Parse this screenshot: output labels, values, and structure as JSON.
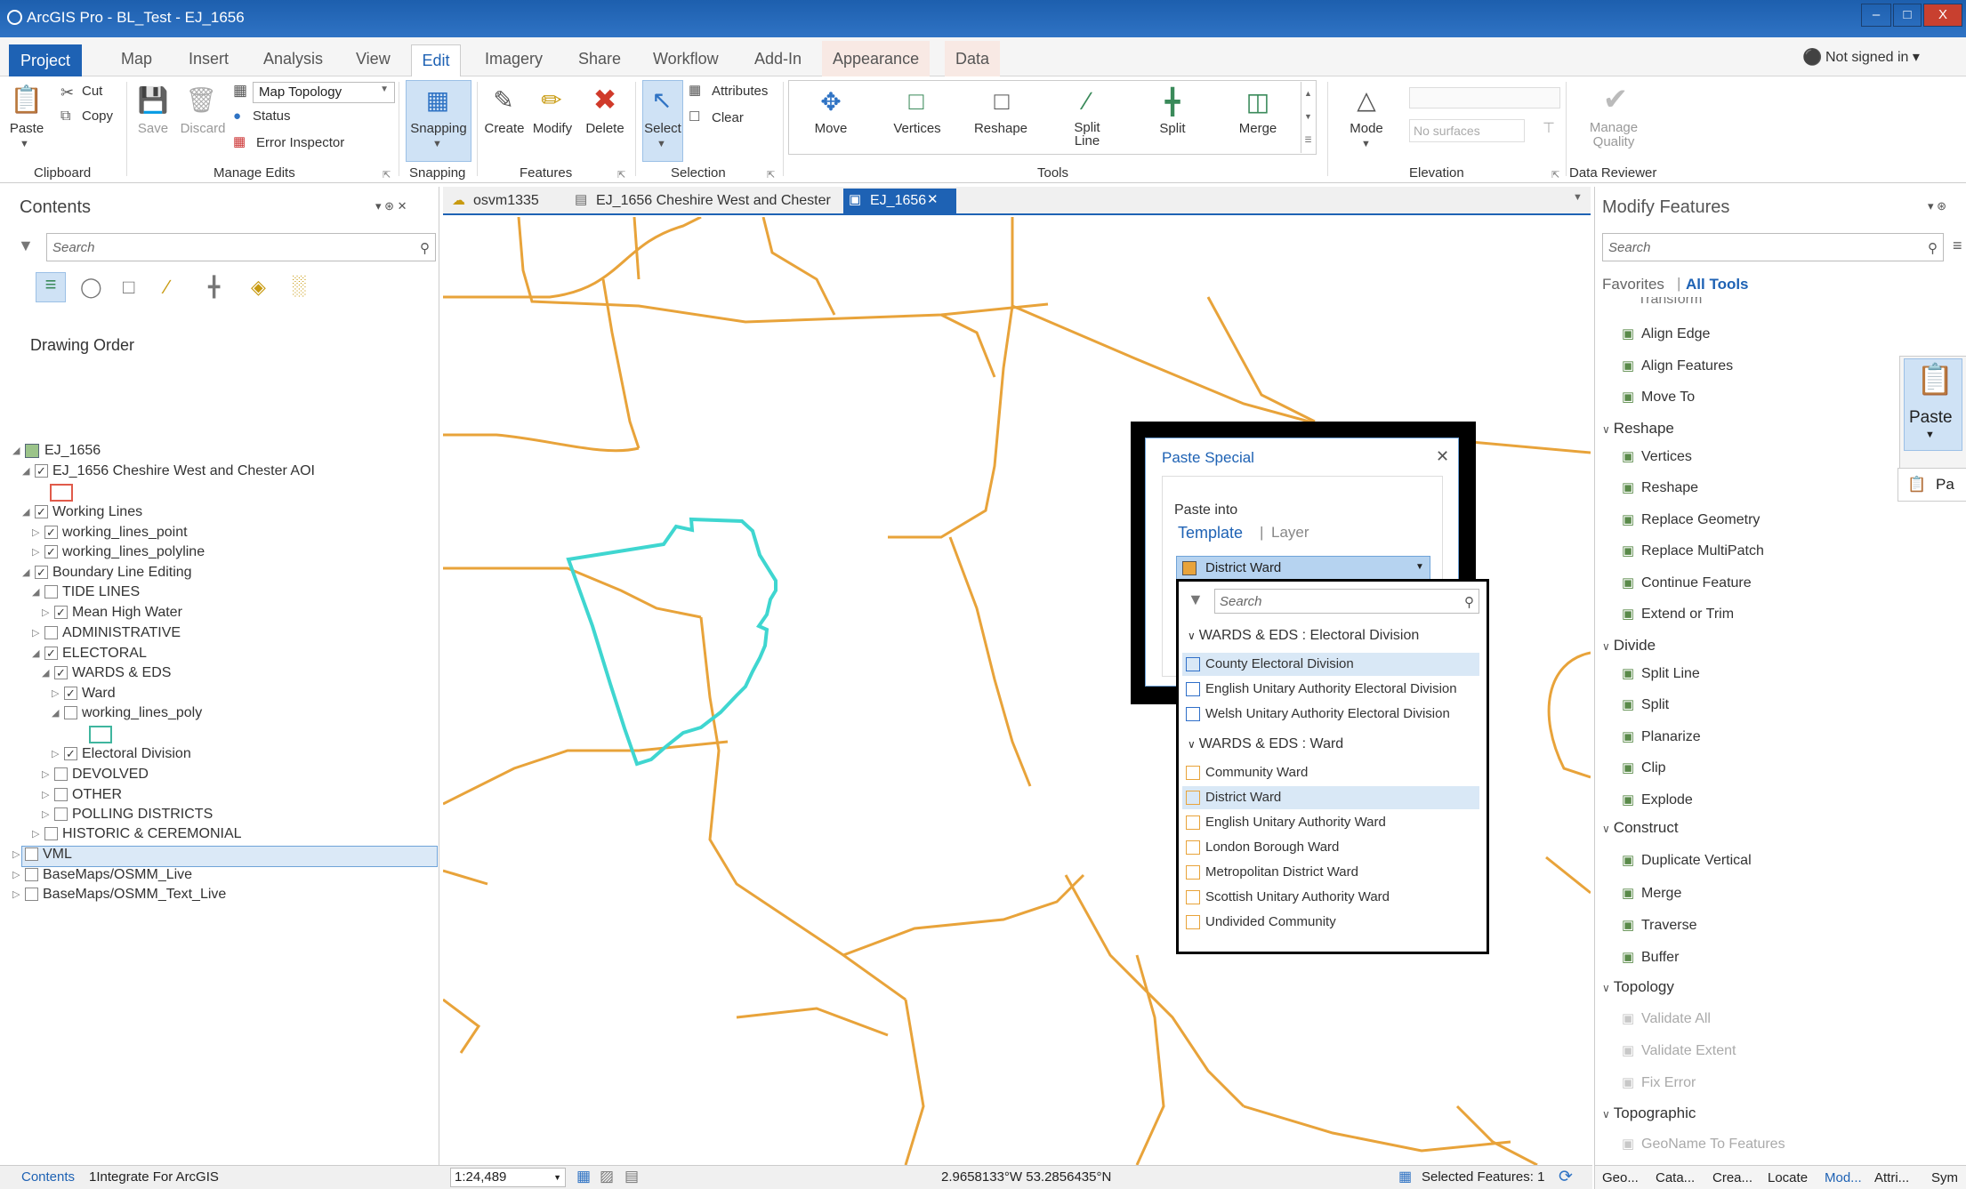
{
  "window": {
    "title": "ArcGIS Pro - BL_Test - EJ_1656",
    "minimize": "–",
    "maximize": "□",
    "close": "X"
  },
  "ribbon_tabs": [
    "Project",
    "Map",
    "Insert",
    "Analysis",
    "View",
    "Edit",
    "Imagery",
    "Share",
    "Workflow",
    "Add-In",
    "Appearance",
    "Data"
  ],
  "signin": "Not signed in ▾",
  "ribbon": {
    "paste": "Paste",
    "cut": "Cut",
    "copy": "Copy",
    "save": "Save",
    "discard": "Discard",
    "map_topology": "Map Topology",
    "status": "Status",
    "error_inspector": "Error Inspector",
    "snapping": "Snapping",
    "create": "Create",
    "modify": "Modify",
    "delete": "Delete",
    "select": "Select",
    "attributes": "Attributes",
    "clear": "Clear",
    "move": "Move",
    "vertices": "Vertices",
    "reshape": "Reshape",
    "split_line": "Split\nLine",
    "split": "Split",
    "merge": "Merge",
    "mode": "Mode",
    "no_surfaces": "No surfaces",
    "manage_quality": "Manage\nQuality",
    "groups": {
      "clipboard": "Clipboard",
      "manage_edits": "Manage Edits",
      "snapping": "Snapping",
      "features": "Features",
      "selection": "Selection",
      "tools": "Tools",
      "elevation": "Elevation",
      "data_reviewer": "Data Reviewer"
    }
  },
  "doc_tabs": [
    "osvm1335",
    "EJ_1656 Cheshire West and Chester",
    "EJ_1656"
  ],
  "contents": {
    "title": "Contents",
    "search_placeholder": "Search",
    "drawing_order": "Drawing Order",
    "tree": [
      {
        "label": "EJ_1656",
        "indent": 0,
        "checked": null,
        "expanded": true
      },
      {
        "label": "EJ_1656 Cheshire West and Chester AOI",
        "indent": 1,
        "checked": true,
        "expanded": true
      },
      {
        "label": "Working Lines",
        "indent": 1,
        "checked": true,
        "expanded": true
      },
      {
        "label": "working_lines_point",
        "indent": 2,
        "checked": true,
        "expanded": false
      },
      {
        "label": "working_lines_polyline",
        "indent": 2,
        "checked": true,
        "expanded": false
      },
      {
        "label": "Boundary Line Editing",
        "indent": 1,
        "checked": true,
        "expanded": true
      },
      {
        "label": "TIDE LINES",
        "indent": 2,
        "checked": false,
        "expanded": true
      },
      {
        "label": "Mean High Water",
        "indent": 3,
        "checked": true,
        "expanded": false
      },
      {
        "label": "ADMINISTRATIVE",
        "indent": 2,
        "checked": false,
        "expanded": false
      },
      {
        "label": "ELECTORAL",
        "indent": 2,
        "checked": true,
        "expanded": true
      },
      {
        "label": "WARDS & EDS",
        "indent": 3,
        "checked": true,
        "expanded": true
      },
      {
        "label": "Ward",
        "indent": 4,
        "checked": true,
        "expanded": false
      },
      {
        "label": "working_lines_poly",
        "indent": 4,
        "checked": false,
        "expanded": true
      },
      {
        "label": "Electoral Division",
        "indent": 4,
        "checked": true,
        "expanded": false
      },
      {
        "label": "DEVOLVED",
        "indent": 3,
        "checked": false,
        "expanded": false
      },
      {
        "label": "OTHER",
        "indent": 3,
        "checked": false,
        "expanded": false
      },
      {
        "label": "POLLING DISTRICTS",
        "indent": 3,
        "checked": false,
        "expanded": false
      },
      {
        "label": "HISTORIC & CEREMONIAL",
        "indent": 2,
        "checked": false,
        "expanded": false
      },
      {
        "label": "VML",
        "indent": 0,
        "checked": false,
        "expanded": false
      },
      {
        "label": "BaseMaps/OSMM_Live",
        "indent": 0,
        "checked": false,
        "expanded": false
      },
      {
        "label": "BaseMaps/OSMM_Text_Live",
        "indent": 0,
        "checked": false,
        "expanded": false
      }
    ]
  },
  "status": {
    "scale": "1:24,489",
    "coords": "2.9658133°W 53.2856435°N",
    "selected": "Selected Features: 1",
    "bottom_tabs": [
      "Contents",
      "1Integrate For ArcGIS"
    ]
  },
  "modify": {
    "title": "Modify Features",
    "search_placeholder": "Search",
    "favorites": "Favorites",
    "all_tools": "All Tools",
    "cut_off": "Transform",
    "items": [
      {
        "kind": "item",
        "label": "Align Edge"
      },
      {
        "kind": "item",
        "label": "Align Features"
      },
      {
        "kind": "item",
        "label": "Move To"
      },
      {
        "kind": "hdr",
        "label": "Reshape"
      },
      {
        "kind": "item",
        "label": "Vertices"
      },
      {
        "kind": "item",
        "label": "Reshape"
      },
      {
        "kind": "item",
        "label": "Replace Geometry"
      },
      {
        "kind": "item",
        "label": "Replace MultiPatch"
      },
      {
        "kind": "item",
        "label": "Continue Feature"
      },
      {
        "kind": "item",
        "label": "Extend or Trim"
      },
      {
        "kind": "hdr",
        "label": "Divide"
      },
      {
        "kind": "item",
        "label": "Split Line"
      },
      {
        "kind": "item",
        "label": "Split"
      },
      {
        "kind": "item",
        "label": "Planarize"
      },
      {
        "kind": "item",
        "label": "Clip"
      },
      {
        "kind": "item",
        "label": "Explode"
      },
      {
        "kind": "hdr",
        "label": "Construct"
      },
      {
        "kind": "item",
        "label": "Duplicate Vertical"
      },
      {
        "kind": "item",
        "label": "Merge"
      },
      {
        "kind": "item",
        "label": "Traverse"
      },
      {
        "kind": "item",
        "label": "Buffer"
      },
      {
        "kind": "hdr",
        "label": "Topology"
      },
      {
        "kind": "dis",
        "label": "Validate All"
      },
      {
        "kind": "dis",
        "label": "Validate Extent"
      },
      {
        "kind": "dis",
        "label": "Fix Error"
      },
      {
        "kind": "hdr",
        "label": "Topographic"
      },
      {
        "kind": "dis",
        "label": "GeoName To Features"
      }
    ],
    "bottom_tabs": [
      "Geo...",
      "Cata...",
      "Crea...",
      "Locate",
      "Mod...",
      "Attri...",
      "Sym"
    ],
    "paste_flyout": "Paste",
    "paste_flyout_item": "Pa"
  },
  "dialog": {
    "title": "Paste Special",
    "paste_into": "Paste into",
    "template_tab": "Template",
    "layer_tab": "Layer",
    "selected": "District Ward",
    "search_placeholder": "Search",
    "groups": [
      {
        "name": "WARDS & EDS : Electoral Division",
        "color": "#2f6fc9",
        "items": [
          "County Electoral Division",
          "English Unitary Authority Electoral Division",
          "Welsh Unitary Authority Electoral Division"
        ]
      },
      {
        "name": "WARDS & EDS : Ward",
        "color": "#e8a33a",
        "items": [
          "Community Ward",
          "District Ward",
          "English Unitary Authority Ward",
          "London Borough Ward",
          "Metropolitan District Ward",
          "Scottish Unitary Authority Ward",
          "Undivided Community"
        ]
      }
    ],
    "highlighted": [
      "County Electoral Division",
      "District Ward"
    ]
  },
  "colors": {
    "accent": "#1e62b4",
    "boundary": "#e8a33a",
    "selection": "#3fd6d0"
  }
}
